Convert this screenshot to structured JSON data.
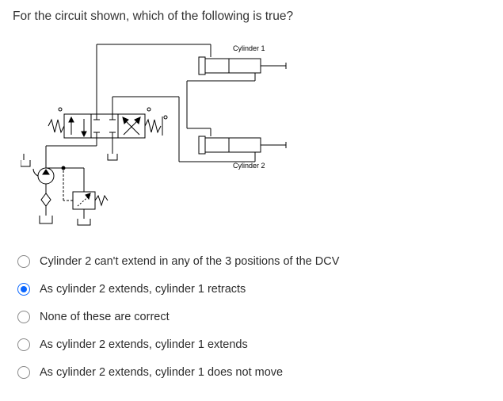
{
  "question": {
    "prompt": "For the circuit shown, which of the following is true?"
  },
  "diagram": {
    "cylinder1_label": "Cylinder 1",
    "cylinder2_label": "Cylinder 2"
  },
  "options": [
    {
      "label": "Cylinder 2 can't extend in any of the 3 positions of the DCV",
      "selected": false
    },
    {
      "label": "As cylinder 2 extends, cylinder 1 retracts",
      "selected": true
    },
    {
      "label": "None of these are correct",
      "selected": false
    },
    {
      "label": "As cylinder 2 extends, cylinder 1 extends",
      "selected": false
    },
    {
      "label": "As cylinder 2 extends, cylinder 1 does not move",
      "selected": false
    }
  ]
}
